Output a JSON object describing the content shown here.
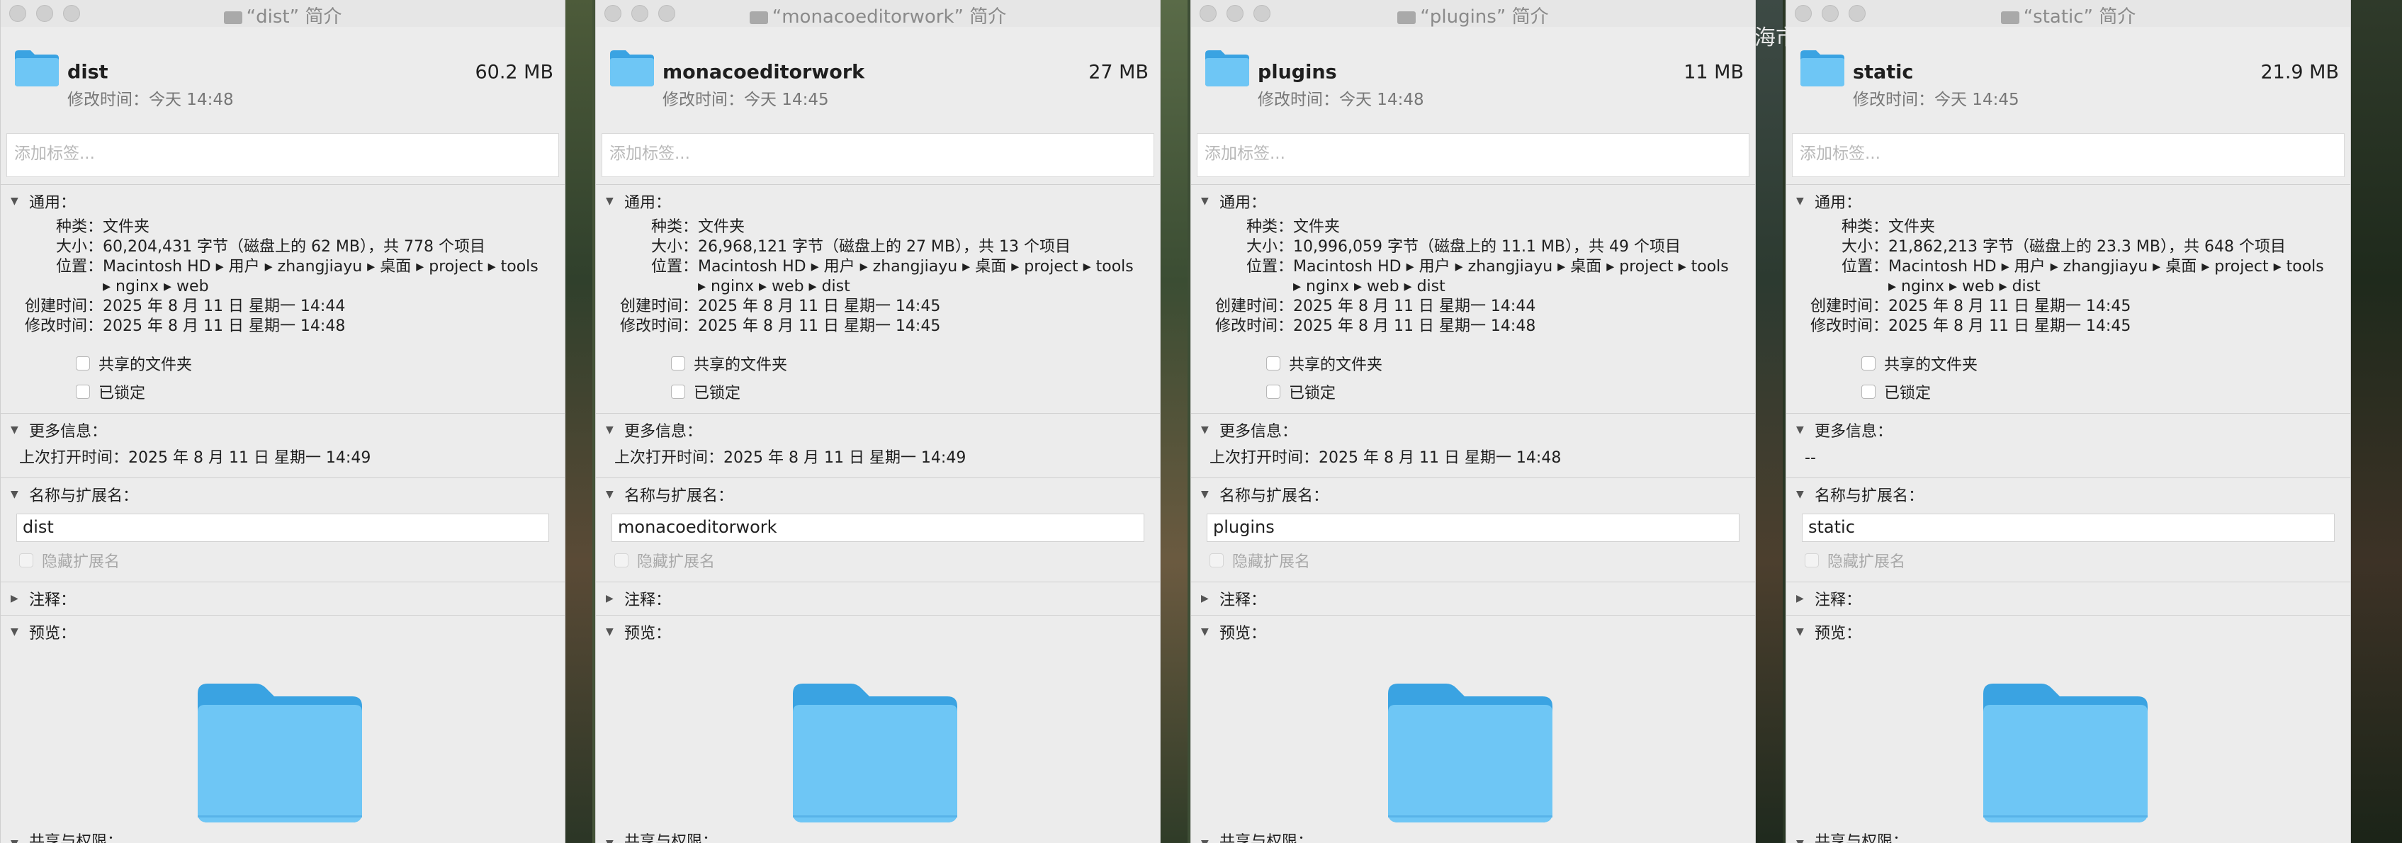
{
  "windows": [
    {
      "title": "“dist” 简介",
      "name": "dist",
      "size": "60.2 MB",
      "modified": "修改时间：今天 14:48",
      "tag_placeholder": "添加标签...",
      "general_label": "通用：",
      "kind_label": "种类：",
      "kind": "文件夹",
      "size_label": "大小：",
      "size_detail": "60,204,431 字节（磁盘上的 62 MB），共 778 个项目",
      "where_label": "位置：",
      "where": "Macintosh HD ▸ 用户 ▸ zhangjiayu ▸ 桌面 ▸ project ▸ tools ▸ nginx ▸ web",
      "created_label": "创建时间：",
      "created": "2025 年 8 月 11 日 星期一 14:44",
      "modified_label": "修改时间：",
      "modified_full": "2025 年 8 月 11 日 星期一 14:48",
      "shared_label": "共享的文件夹",
      "locked_label": "已锁定",
      "more_label": "更多信息：",
      "more_value": "上次打开时间：2025 年 8 月 11 日 星期一 14:49",
      "name_ext_label": "名称与扩展名：",
      "name_value": "dist",
      "hide_ext_label": "隐藏扩展名",
      "comments_label": "注释：",
      "preview_label": "预览：",
      "sharing_label": "共享与权限："
    },
    {
      "title": "“monacoeditorwork” 简介",
      "name": "monacoeditorwork",
      "size": "27 MB",
      "modified": "修改时间：今天 14:45",
      "tag_placeholder": "添加标签...",
      "general_label": "通用：",
      "kind_label": "种类：",
      "kind": "文件夹",
      "size_label": "大小：",
      "size_detail": "26,968,121 字节（磁盘上的 27 MB），共 13 个项目",
      "where_label": "位置：",
      "where": "Macintosh HD ▸ 用户 ▸ zhangjiayu ▸ 桌面 ▸ project ▸ tools ▸ nginx ▸ web ▸ dist",
      "created_label": "创建时间：",
      "created": "2025 年 8 月 11 日 星期一 14:45",
      "modified_label": "修改时间：",
      "modified_full": "2025 年 8 月 11 日 星期一 14:45",
      "shared_label": "共享的文件夹",
      "locked_label": "已锁定",
      "more_label": "更多信息：",
      "more_value": "上次打开时间：2025 年 8 月 11 日 星期一 14:49",
      "name_ext_label": "名称与扩展名：",
      "name_value": "monacoeditorwork",
      "hide_ext_label": "隐藏扩展名",
      "comments_label": "注释：",
      "preview_label": "预览：",
      "sharing_label": "共享与权限："
    },
    {
      "title": "“plugins” 简介",
      "name": "plugins",
      "size": "11 MB",
      "modified": "修改时间：今天 14:48",
      "tag_placeholder": "添加标签...",
      "general_label": "通用：",
      "kind_label": "种类：",
      "kind": "文件夹",
      "size_label": "大小：",
      "size_detail": "10,996,059 字节（磁盘上的 11.1 MB），共 49 个项目",
      "where_label": "位置：",
      "where": "Macintosh HD ▸ 用户 ▸ zhangjiayu ▸ 桌面 ▸ project ▸ tools ▸ nginx ▸ web ▸ dist",
      "created_label": "创建时间：",
      "created": "2025 年 8 月 11 日 星期一 14:44",
      "modified_label": "修改时间：",
      "modified_full": "2025 年 8 月 11 日 星期一 14:48",
      "shared_label": "共享的文件夹",
      "locked_label": "已锁定",
      "more_label": "更多信息：",
      "more_value": "上次打开时间：2025 年 8 月 11 日 星期一 14:48",
      "name_ext_label": "名称与扩展名：",
      "name_value": "plugins",
      "hide_ext_label": "隐藏扩展名",
      "comments_label": "注释：",
      "preview_label": "预览：",
      "sharing_label": "共享与权限："
    },
    {
      "title": "“static” 简介",
      "name": "static",
      "size": "21.9 MB",
      "modified": "修改时间：今天 14:45",
      "tag_placeholder": "添加标签...",
      "general_label": "通用：",
      "kind_label": "种类：",
      "kind": "文件夹",
      "size_label": "大小：",
      "size_detail": "21,862,213 字节（磁盘上的 23.3 MB），共 648 个项目",
      "where_label": "位置：",
      "where": "Macintosh HD ▸ 用户 ▸ zhangjiayu ▸ 桌面 ▸ project ▸ tools ▸ nginx ▸ web ▸ dist",
      "created_label": "创建时间：",
      "created": "2025 年 8 月 11 日 星期一 14:45",
      "modified_label": "修改时间：",
      "modified_full": "2025 年 8 月 11 日 星期一 14:45",
      "shared_label": "共享的文件夹",
      "locked_label": "已锁定",
      "more_label": "更多信息：",
      "more_value": "--",
      "name_ext_label": "名称与扩展名：",
      "name_value": "static",
      "hide_ext_label": "隐藏扩展名",
      "comments_label": "注释：",
      "preview_label": "预览：",
      "sharing_label": "共享与权限："
    }
  ],
  "desktop": {
    "partial_text": "海市"
  },
  "colors": {
    "folder_light": "#6ec6f5",
    "folder_dark": "#3aa3e2",
    "window_bg": "#ececec"
  },
  "icons": [
    "folder-icon",
    "disclosure-chevron-icon",
    "traffic-light-icon"
  ]
}
